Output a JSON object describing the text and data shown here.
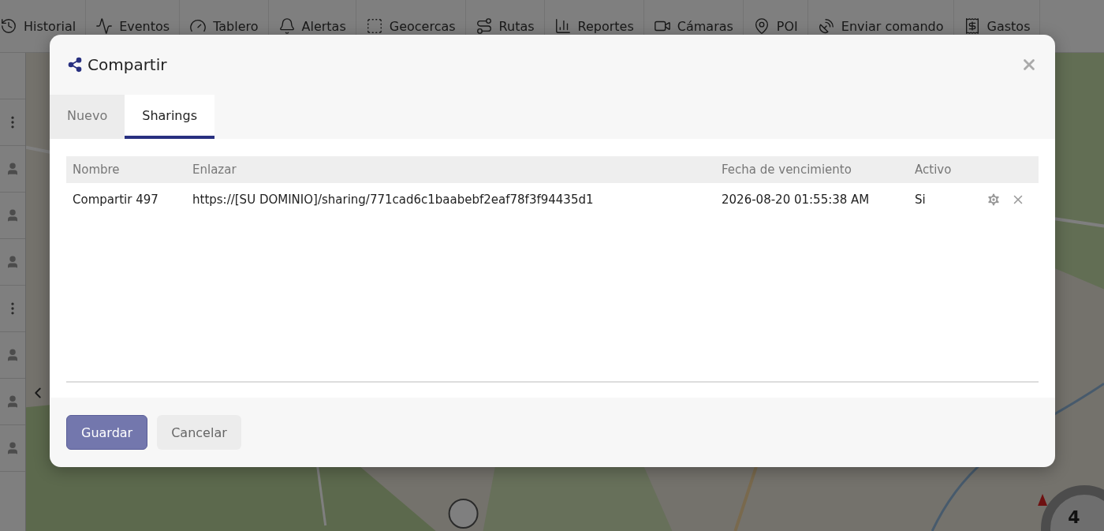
{
  "nav": [
    {
      "label": "Historial"
    },
    {
      "label": "Eventos"
    },
    {
      "label": "Tablero"
    },
    {
      "label": "Alertas"
    },
    {
      "label": "Geocercas"
    },
    {
      "label": "Rutas"
    },
    {
      "label": "Reportes"
    },
    {
      "label": "Cámaras"
    },
    {
      "label": "POI"
    },
    {
      "label": "Enviar comando"
    },
    {
      "label": "Gastos"
    }
  ],
  "map": {
    "kind": "picture",
    "cluster_count": "4"
  },
  "dialog": {
    "title": "Compartir",
    "tabs": [
      {
        "label": "Nuevo",
        "selected": false
      },
      {
        "label": "Sharings",
        "selected": true
      }
    ],
    "table": {
      "columns": [
        "Nombre",
        "Enlazar",
        "Fecha de vencimiento",
        "Activo"
      ],
      "rows": [
        {
          "cells": [
            "Compartir 497",
            "https://[SU DOMINIO]/sharing/771cad6c1baabebf2eaf78f3f94435d1",
            "2026-08-20 01:55:38 AM",
            "Si"
          ]
        }
      ]
    },
    "buttons": [
      {
        "label": "Guardar",
        "kind": "primary"
      },
      {
        "label": "Cancelar",
        "kind": "secondary"
      }
    ]
  }
}
